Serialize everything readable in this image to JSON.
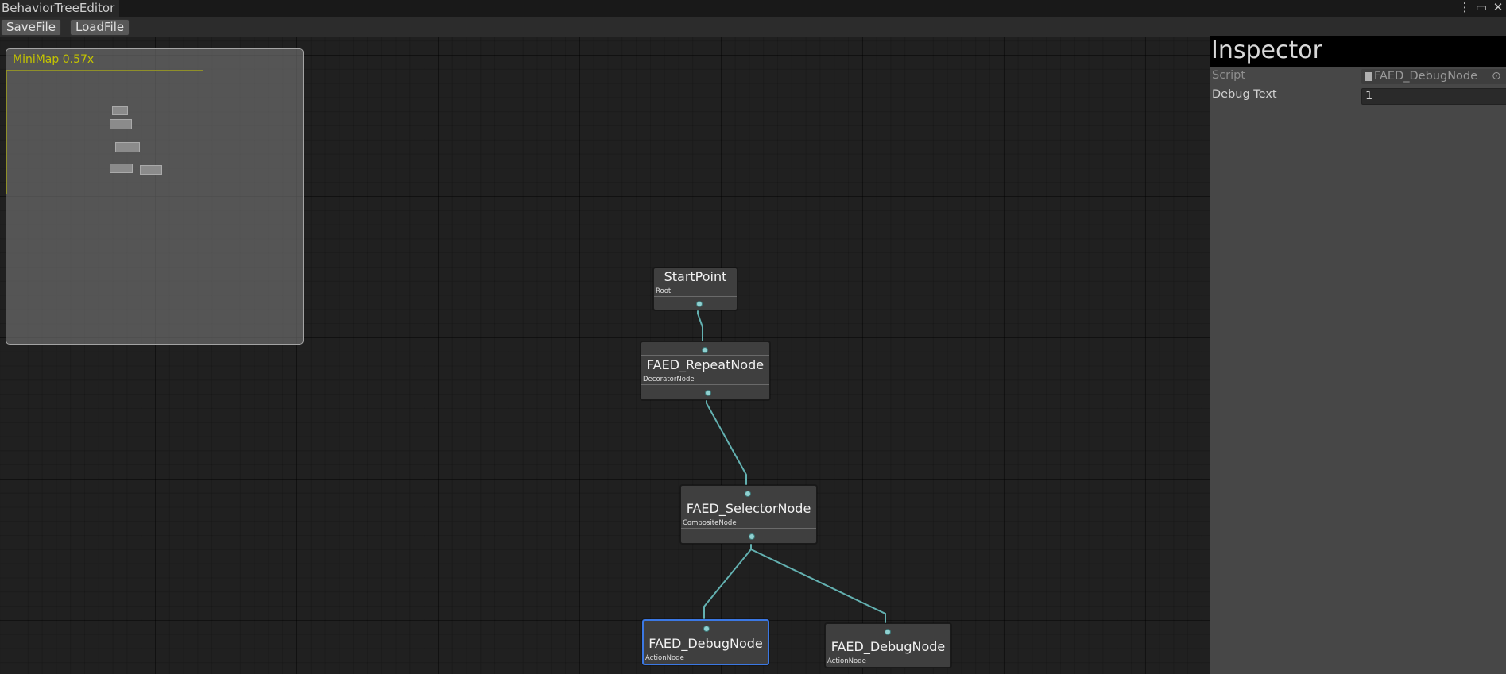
{
  "window": {
    "title": "BehaviorTreeEditor"
  },
  "toolbar": {
    "save_label": "SaveFile",
    "load_label": "LoadFile"
  },
  "minimap": {
    "label": "MiniMap  0.57x"
  },
  "nodes": {
    "start": {
      "title": "StartPoint",
      "type": "Root"
    },
    "repeat": {
      "title": "FAED_RepeatNode",
      "type": "DecoratorNode"
    },
    "selector": {
      "title": "FAED_SelectorNode",
      "type": "CompositeNode"
    },
    "debug1": {
      "title": "FAED_DebugNode",
      "type": "ActionNode",
      "selected": true
    },
    "debug2": {
      "title": "FAED_DebugNode",
      "type": "ActionNode"
    }
  },
  "inspector": {
    "title": "Inspector",
    "script_label": "Script",
    "script_value": "FAED_DebugNode",
    "debug_text_label": "Debug Text",
    "debug_text_value": "1"
  },
  "colors": {
    "edge": "#63b1b1",
    "selection": "#3b78e4",
    "minimap_label": "#c4c400"
  },
  "icons": [
    "kebab-menu-icon",
    "maximize-icon",
    "close-icon",
    "script-file-icon",
    "object-picker-icon"
  ]
}
